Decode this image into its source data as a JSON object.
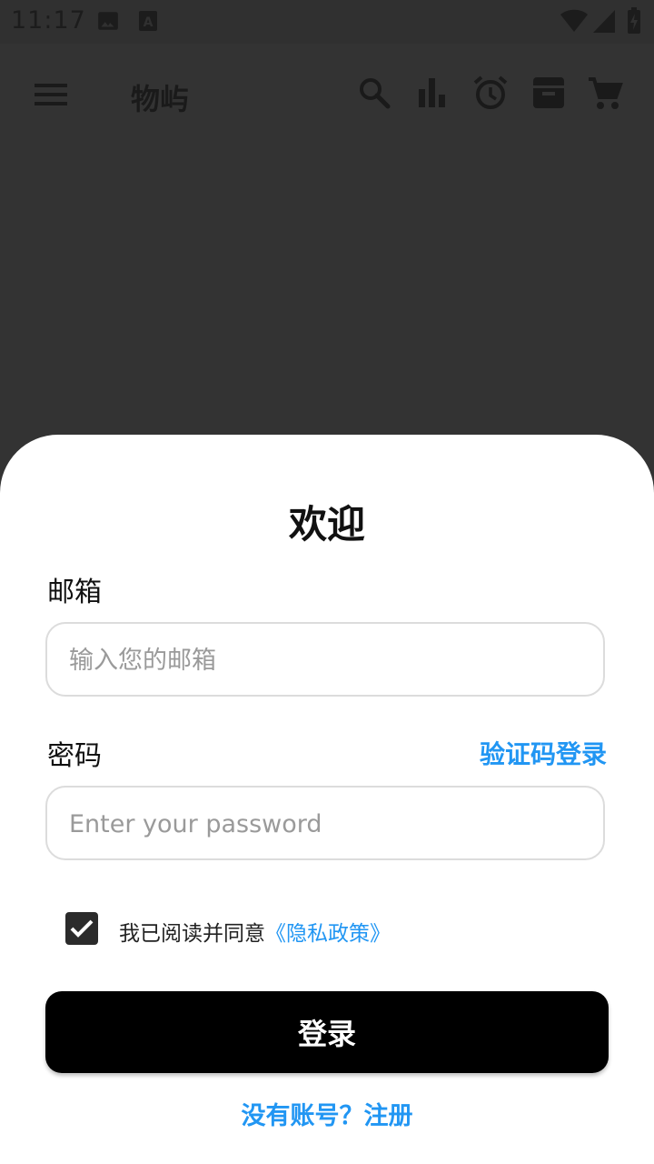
{
  "status_bar": {
    "time": "11:17",
    "icons": [
      "image-icon",
      "keyboard-a-icon",
      "wifi-icon",
      "signal-icon",
      "battery-charging-icon"
    ]
  },
  "app_bar": {
    "title": "物屿",
    "icons": [
      "menu-icon",
      "search-icon",
      "bar-chart-icon",
      "alarm-icon",
      "archive-icon",
      "cart-icon"
    ]
  },
  "login_sheet": {
    "title": "欢迎",
    "email_label": "邮箱",
    "email_placeholder": "输入您的邮箱",
    "email_value": "",
    "password_label": "密码",
    "password_placeholder": "Enter your password",
    "password_value": "",
    "code_login_link": "验证码登录",
    "agree_checked": true,
    "agree_text": "我已阅读并同意",
    "policy_link": "《隐私政策》",
    "login_button": "登录",
    "register_link": "没有账号？注册"
  },
  "colors": {
    "accent": "#2196f3",
    "scrim": "#333333",
    "button": "#000000"
  }
}
